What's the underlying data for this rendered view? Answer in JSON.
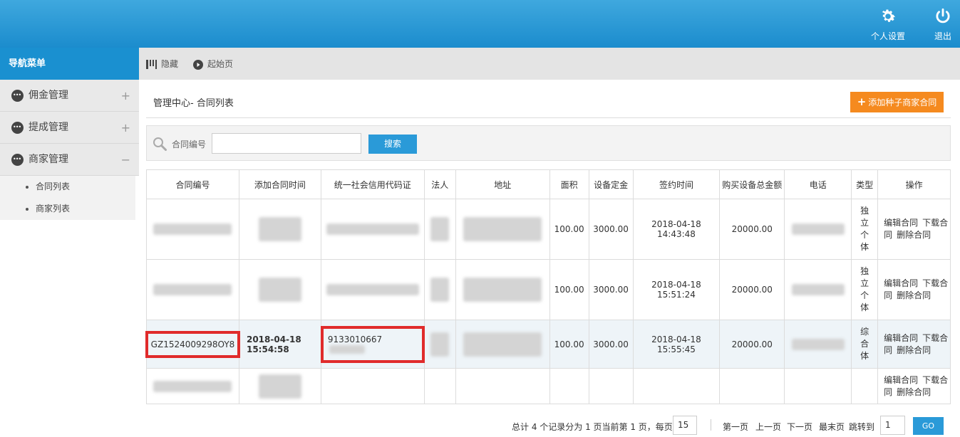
{
  "header": {
    "settings_label": "个人设置",
    "logout_label": "退出",
    "bg_color": "#1b8ccd"
  },
  "sidebar": {
    "title": "导航菜单",
    "groups": [
      {
        "label": "佣金管理",
        "toggle": "+"
      },
      {
        "label": "提成管理",
        "toggle": "+"
      },
      {
        "label": "商家管理",
        "toggle": "−"
      }
    ],
    "sub_items": [
      {
        "label": "合同列表"
      },
      {
        "label": "商家列表"
      }
    ]
  },
  "toolbar": {
    "hide_label": "隐藏",
    "home_label": "起始页"
  },
  "page": {
    "breadcrumb": "管理中心- 合同列表",
    "add_button": "添加种子商家合同",
    "add_color": "#f58a1f"
  },
  "search": {
    "label": "合同编号",
    "value": "",
    "button": "搜索",
    "button_color": "#2a9ad8"
  },
  "table": {
    "headers": [
      "合同编号",
      "添加合同时间",
      "统一社会信用代码证",
      "法人",
      "地址",
      "面积",
      "设备定金",
      "签约时间",
      "购买设备总金额",
      "电话",
      "类型",
      "操作"
    ],
    "rows": [
      {
        "contract_no": "",
        "added_time": "",
        "credit_code": "",
        "area": "100.00",
        "deposit": "3000.00",
        "signed": "2018-04-18 14:43:48",
        "total": "20000.00",
        "type": "独立个体"
      },
      {
        "contract_no": "",
        "added_time": "",
        "credit_code": "",
        "area": "100.00",
        "deposit": "3000.00",
        "signed": "2018-04-18 15:51:24",
        "total": "20000.00",
        "type": "独立个体"
      },
      {
        "contract_no": "GZ1524009298OY8",
        "added_time": "2018-04-18 15:54:58",
        "credit_code": "9133010667",
        "area": "100.00",
        "deposit": "3000.00",
        "signed": "2018-04-18 15:55:45",
        "total": "20000.00",
        "type": "综合体"
      },
      {
        "contract_no": "",
        "added_time": "",
        "credit_code": "",
        "area": "",
        "deposit": "",
        "signed": "",
        "total": "",
        "type": ""
      }
    ],
    "ops": {
      "edit": "编辑合同",
      "download": "下载合同",
      "delete": "删除合同"
    }
  },
  "pager": {
    "summary": "总计 4 个记录分为 1 页当前第 1 页，每页",
    "page_size": "15",
    "first": "第一页",
    "prev": "上一页",
    "next": "下一页",
    "last": "最末页",
    "jump_label": "跳转到",
    "jump_value": "1",
    "go": "GO"
  }
}
